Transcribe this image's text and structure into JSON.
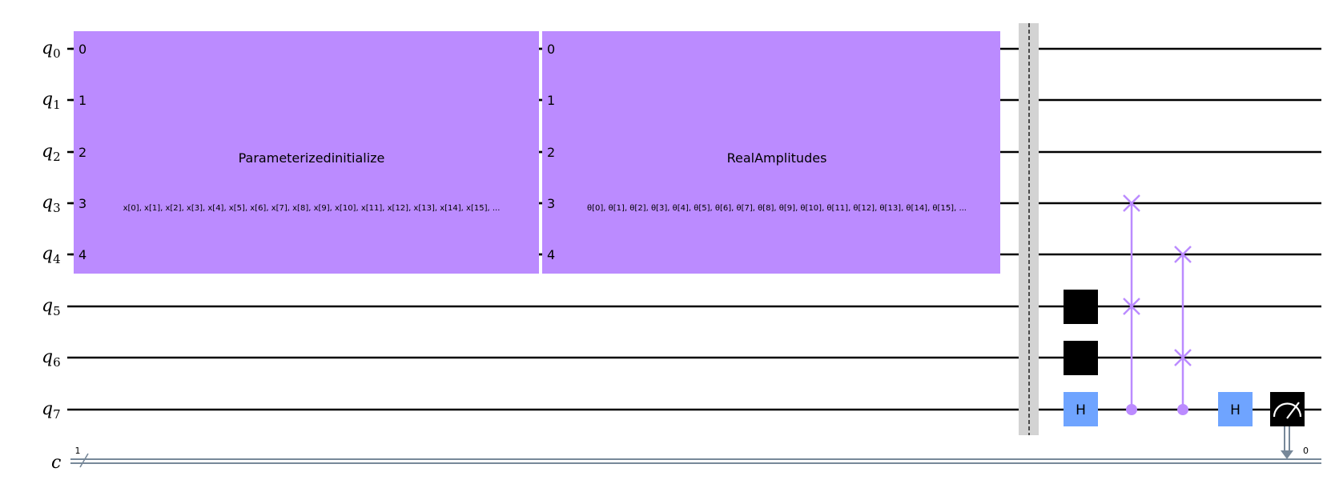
{
  "qubits": [
    {
      "base": "q",
      "index": "0"
    },
    {
      "base": "q",
      "index": "1"
    },
    {
      "base": "q",
      "index": "2"
    },
    {
      "base": "q",
      "index": "3"
    },
    {
      "base": "q",
      "index": "4"
    },
    {
      "base": "q",
      "index": "5"
    },
    {
      "base": "q",
      "index": "6"
    },
    {
      "base": "q",
      "index": "7"
    }
  ],
  "classical": {
    "label": "c",
    "width": "1",
    "measure_bit": "0"
  },
  "colors": {
    "block": "#bb8bff",
    "swap": "#bb8bff",
    "hadamard": "#6fa4ff",
    "reset": "#000000",
    "measure": "#000000",
    "barrier": "#d3d3d3",
    "classical_wire": "#778899"
  },
  "blocks": {
    "parameterized_initialize": {
      "name": "Parameterizedinitialize",
      "params": "x[0], x[1], x[2], x[3], x[4], x[5], x[6], x[7], x[8], x[9], x[10], x[11], x[12], x[13], x[14], x[15], ...",
      "ports": [
        "0",
        "1",
        "2",
        "3",
        "4"
      ]
    },
    "real_amplitudes": {
      "name": "RealAmplitudes",
      "params": "θ[0], θ[1], θ[2], θ[3], θ[4], θ[5], θ[6], θ[7], θ[8], θ[9], θ[10], θ[11], θ[12], θ[13], θ[14], θ[15], ...",
      "ports": [
        "0",
        "1",
        "2",
        "3",
        "4"
      ]
    }
  },
  "gates": {
    "reset_label": "|0⟩",
    "hadamard_label": "H"
  }
}
